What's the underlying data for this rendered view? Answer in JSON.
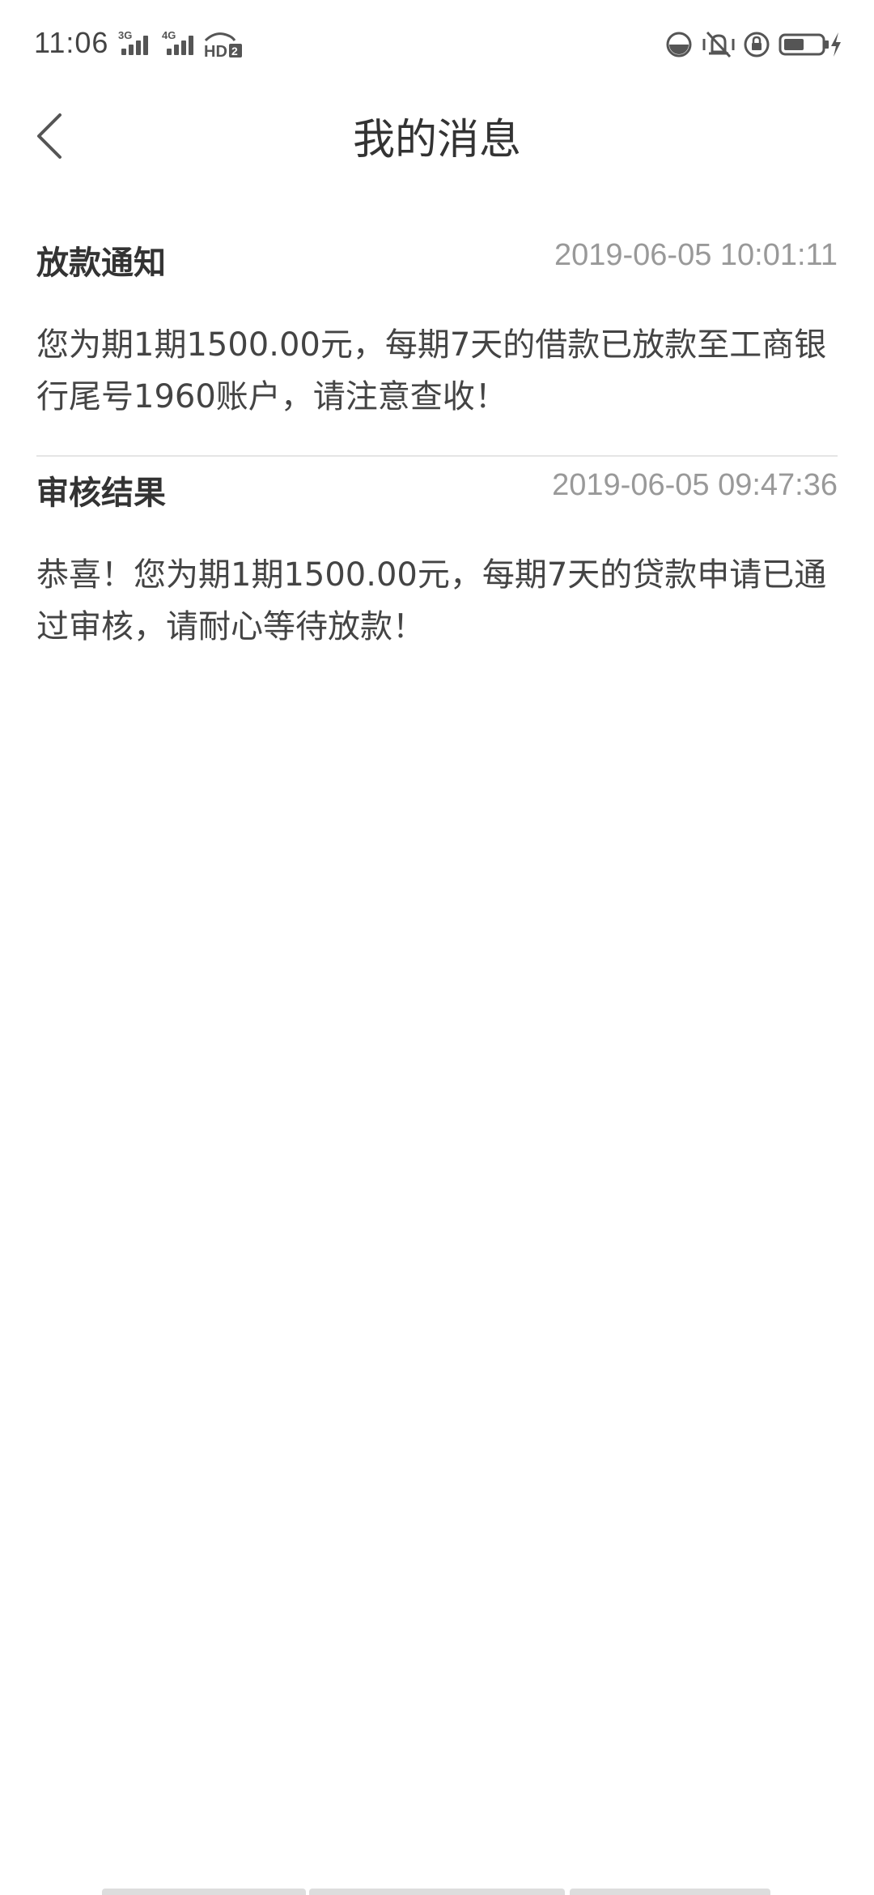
{
  "status_bar": {
    "time": "11:06",
    "network_1": "3G",
    "network_2": "4G",
    "hd_label": "HD2",
    "icons": [
      "signal-icon",
      "signal-icon",
      "hd-call-icon",
      "data-saver-icon",
      "vibrate-icon",
      "rotation-lock-icon",
      "battery-icon",
      "charging-icon"
    ]
  },
  "header": {
    "title": "我的消息",
    "back_icon": "chevron-left-icon"
  },
  "messages": [
    {
      "title": "放款通知",
      "time": "2019-06-05 10:01:11",
      "body": "您为期1期1500.00元，每期7天的借款已放款至工商银行尾号1960账户，请注意查收！"
    },
    {
      "title": "审核结果",
      "time": "2019-06-05 09:47:36",
      "body": "恭喜！您为期1期1500.00元，每期7天的贷款申请已通过审核，请耐心等待放款！"
    }
  ],
  "colors": {
    "background": "#ffffff",
    "title_text": "#333333",
    "time_text": "#999999",
    "divider": "#e5e5e5"
  }
}
